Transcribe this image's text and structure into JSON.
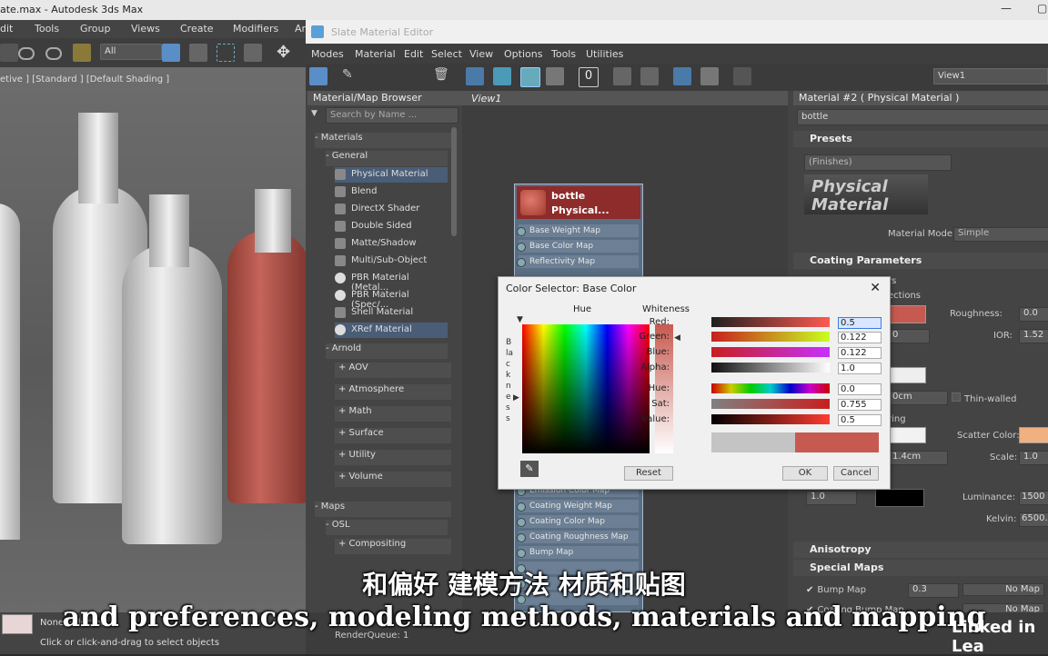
{
  "app": {
    "title": "ate.max - Autodesk 3ds Max",
    "menu": [
      "dit",
      "Tools",
      "Group",
      "Views",
      "Create",
      "Modifiers",
      "Ar"
    ],
    "selection_filter": "All",
    "viewport_label": "etive ] [Standard ] [Default Shading ]",
    "status": {
      "selection": "None Selected",
      "hint": "Click or click-and-drag to select objects",
      "renderqueue": "RenderQueue: 1"
    }
  },
  "slate": {
    "title": "Slate Material Editor",
    "menu": [
      "Modes",
      "Material",
      "Edit",
      "Select",
      "View",
      "Options",
      "Tools",
      "Utilities"
    ],
    "view_dropdown": "View1",
    "browser": {
      "title": "Material/Map Browser",
      "search_placeholder": "Search by Name ...",
      "materials_header": "- Materials",
      "general_header": "- General",
      "general_items": [
        "Physical Material",
        "Blend",
        "DirectX Shader",
        "Double Sided",
        "Matte/Shadow",
        "Multi/Sub-Object",
        "PBR Material (Metal...",
        "PBR Material (Spec/...",
        "Shell Material",
        "XRef Material"
      ],
      "arnold_header": "- Arnold",
      "arnold_items": [
        "+ AOV",
        "+ Atmosphere",
        "+ Math",
        "+ Surface",
        "+ Utility",
        "+ Volume"
      ],
      "maps_header": "- Maps",
      "osl_header": "- OSL",
      "osl_items": [
        "+ Compositing"
      ]
    },
    "view_tab": "View1",
    "node": {
      "name": "bottle",
      "type": "Physical...",
      "slots_top": [
        "Base Weight Map",
        "Base Color Map",
        "Reflectivity Map"
      ],
      "slots_bottom": [
        "Emission Color Map",
        "Coating Weight Map",
        "Coating Color Map",
        "Coating Roughness Map",
        "Bump Map"
      ]
    },
    "params": {
      "title": "Material #2 ( Physical Material )",
      "name_field": "bottle",
      "presets_header": "Presets",
      "presets_value": "(Finishes)",
      "logo_text": "Physical Material",
      "mode_label": "Material Mode:",
      "mode_value": "Simple",
      "coating_header": "Coating Parameters",
      "roughness_label": "Roughness:",
      "roughness_value": "0.0",
      "ior_label": "IOR:",
      "ior_value": "1.52",
      "thin_walled": "Thin-walled",
      "scatter_label": "Scatter Color:",
      "scale_label": "Scale:",
      "scale_value": "1.0",
      "depth_value": "0cm",
      "scale2_value": "1.4cm",
      "lum_field": "1.0",
      "luminance_label": "Luminance:",
      "luminance_value": "1500",
      "kelvin_label": "Kelvin:",
      "kelvin_value": "6500.0",
      "anisotropy_header": "Anisotropy",
      "special_header": "Special Maps",
      "bump_label": "Bump Map",
      "bump_value": "0.3",
      "nomap": "No Map",
      "coat_bump_label": "Coating Bump Map",
      "frag": [
        "rs",
        "ections",
        "0",
        "ring"
      ]
    }
  },
  "color_selector": {
    "title": "Color Selector: Base Color",
    "hue_label": "Hue",
    "whiteness_label": "Whiteness",
    "blackness_label": "Blackness",
    "channels": [
      {
        "label": "Red:",
        "value": "0.5"
      },
      {
        "label": "Green:",
        "value": "0.122"
      },
      {
        "label": "Blue:",
        "value": "0.122"
      },
      {
        "label": "Alpha:",
        "value": "1.0"
      },
      {
        "label": "Hue:",
        "value": "0.0"
      },
      {
        "label": "Sat:",
        "value": "0.755"
      },
      {
        "label": "Value:",
        "value": "0.5"
      }
    ],
    "reset_label": "Reset",
    "ok_label": "OK",
    "cancel_label": "Cancel",
    "base_color": "#c75a50"
  },
  "subtitles": {
    "cn": "和偏好 建模方法 材质和贴图",
    "en": "and preferences, modeling methods, materials and mapping"
  },
  "watermark": "Linked in Lea"
}
